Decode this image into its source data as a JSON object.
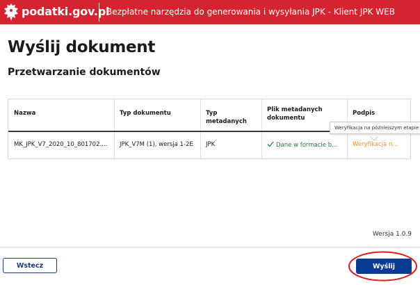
{
  "header": {
    "logo_text": "podatki.gov.pl",
    "app_title": "Bezpłatne narzędzia do generowania i wysyłania JPK - Klient JPK WEB",
    "brand_color": "#d5232f"
  },
  "page": {
    "title": "Wyślij dokument",
    "subtitle": "Przetwarzanie dokumentów"
  },
  "table": {
    "headers": [
      "Nazwa",
      "Typ dokumentu",
      "Typ metadanych",
      "Plik metadanych dokumentu",
      "Podpis"
    ],
    "rows": [
      {
        "name": "MK_JPK_V7_2020_10_801702....",
        "doc_type": "JPK_V7M (1), wersja 1-2E",
        "meta_type": "JPK",
        "meta_file_status": "Dane w formacie b...",
        "signature_status": "Weryfikacja n..."
      }
    ]
  },
  "tooltip": {
    "text": "Weryfikacja na późniejszym etapie"
  },
  "version": "Wersja 1.0.9",
  "buttons": {
    "back": "Wstecz",
    "send": "Wyślij"
  },
  "colors": {
    "ok": "#2e7d32",
    "pending": "#f2902a",
    "primary": "#0a3a92",
    "annotation": "#d81e1e"
  }
}
